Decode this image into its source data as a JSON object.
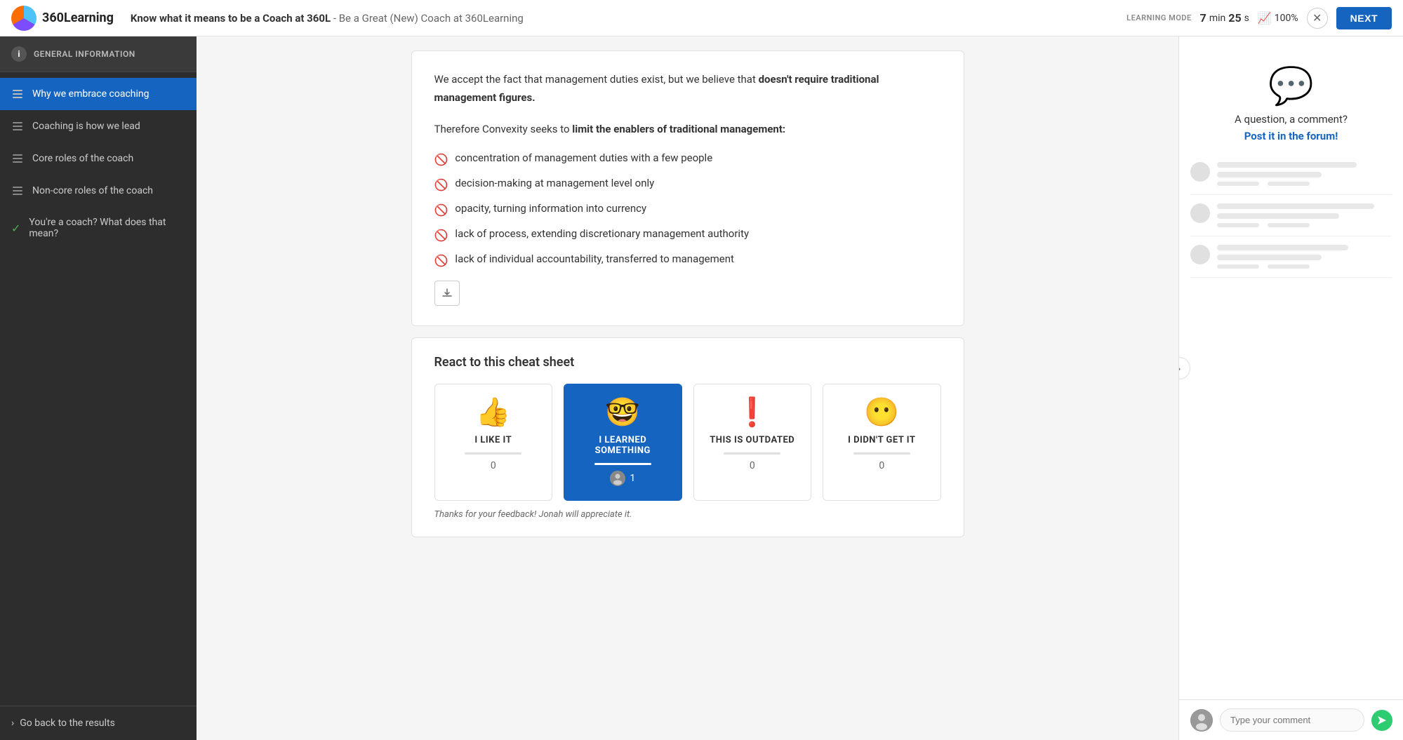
{
  "header": {
    "logo_text": "360Learning",
    "course_title": "Know what it means to be a Coach at 360L",
    "course_subtitle": " - Be a Great (New) Coach at 360Learning",
    "learning_mode": "LEARNING MODE",
    "timer_min": "7",
    "timer_min_label": "min",
    "timer_sec": "25",
    "timer_sec_label": "s",
    "progress": "100%",
    "next_label": "NEXT"
  },
  "sidebar": {
    "info_label": "GENERAL INFORMATION",
    "items": [
      {
        "label": "Why we embrace coaching",
        "active": true,
        "icon": "list",
        "checked": false
      },
      {
        "label": "Coaching is how we lead",
        "active": false,
        "icon": "list",
        "checked": false
      },
      {
        "label": "Core roles of the coach",
        "active": false,
        "icon": "list",
        "checked": false
      },
      {
        "label": "Non-core roles of the coach",
        "active": false,
        "icon": "list",
        "checked": false
      },
      {
        "label": "You're a coach? What does that mean?",
        "active": false,
        "icon": "list",
        "checked": true
      }
    ],
    "go_back_label": "Go back to the results"
  },
  "content": {
    "paragraph1_before": "We accept the fact that management duties exist, but we believe that ",
    "paragraph1_bold": "doesn't require traditional management figures.",
    "paragraph2_before": "Therefore Convexity seeks to ",
    "paragraph2_bold": "limit the enablers of traditional management:",
    "bullet_items": [
      "concentration of management duties with a few people",
      "decision-making at management level only",
      "opacity, turning information into currency",
      "lack of process, extending discretionary management authority",
      "lack of individual accountability, transferred to management"
    ]
  },
  "react_section": {
    "title": "React to this cheat sheet",
    "options": [
      {
        "id": "like",
        "emoji": "👍",
        "label": "I LIKE IT",
        "count": "0",
        "selected": false
      },
      {
        "id": "learned",
        "emoji": "🤓",
        "label": "I LEARNED SOMETHING",
        "count": "1",
        "selected": true
      },
      {
        "id": "outdated",
        "emoji": "❗",
        "label": "THIS IS OUTDATED",
        "count": "0",
        "selected": false
      },
      {
        "id": "didnt-get",
        "emoji": "😶",
        "label": "I DIDN'T GET IT",
        "count": "0",
        "selected": false
      }
    ],
    "feedback_text": "Thanks for your feedback! Jonah will appreciate it."
  },
  "right_panel": {
    "forum_text": "A question, a comment?",
    "forum_link": "Post it in the forum!",
    "comment_placeholder": "Type your comment"
  }
}
